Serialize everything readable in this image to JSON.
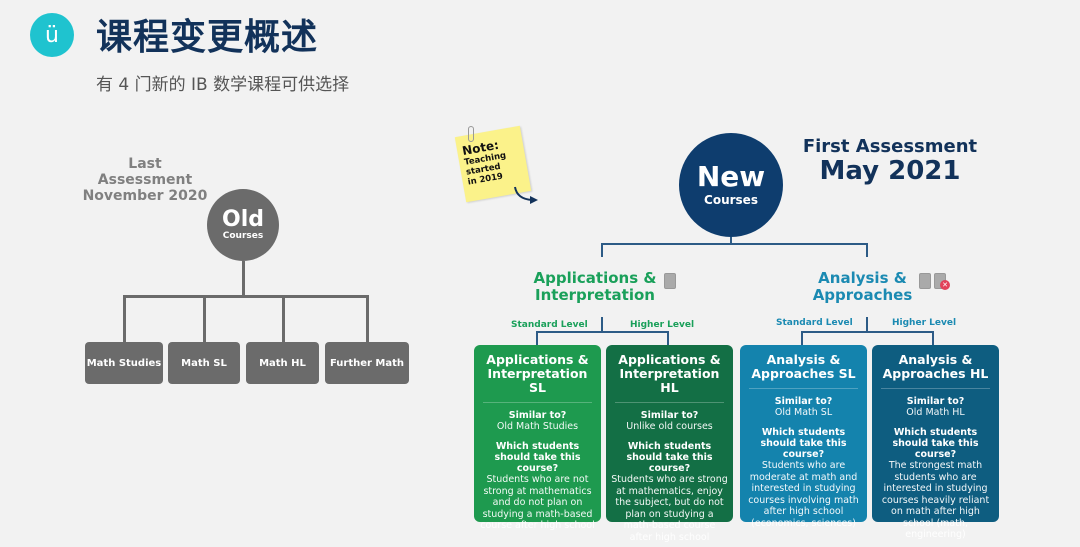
{
  "header": {
    "logo_glyph": "ü",
    "title": "课程变更概述",
    "subtitle": "有 4 门新的 IB 数学课程可供选择"
  },
  "old": {
    "label_line1": "Last Assessment",
    "label_line2": "November 2020",
    "circle_big": "Old",
    "circle_small": "Courses",
    "courses": [
      "Math Studies",
      "Math SL",
      "Math HL",
      "Further Math"
    ]
  },
  "note": {
    "heading": "Note:",
    "line1": "Teaching",
    "line2": "started",
    "line3": "in 2019"
  },
  "new": {
    "circle_big": "New",
    "circle_small": "Courses",
    "assess_line1": "First Assessment",
    "assess_line2": "May 2021",
    "paths": [
      {
        "title_line1": "Applications &",
        "title_line2": "Interpretation",
        "sl_label": "Standard Level",
        "hl_label": "Higher Level"
      },
      {
        "title_line1": "Analysis &",
        "title_line2": "Approaches",
        "sl_label": "Standard Level",
        "hl_label": "Higher Level"
      }
    ],
    "cards": [
      {
        "title_line1": "Applications &",
        "title_line2": "Interpretation SL",
        "similar_heading": "Similar to?",
        "similar_value": "Old Math Studies",
        "who_heading": "Which students should take this course?",
        "who_text": "Students who are not strong at mathematics and do not plan on studying a math-based course after high school",
        "color": "#1e9a4f"
      },
      {
        "title_line1": "Applications &",
        "title_line2": "Interpretation HL",
        "similar_heading": "Similar to?",
        "similar_value": "Unlike old courses",
        "who_heading": "Which students should take this course?",
        "who_text": "Students who are strong at mathematics, enjoy the subject, but do not plan on studying a math-based course after high school",
        "color": "#136f45"
      },
      {
        "title_line1": "Analysis &",
        "title_line2": "Approaches SL",
        "similar_heading": "Similar to?",
        "similar_value": "Old Math SL",
        "who_heading": "Which students should take this course?",
        "who_text": "Students who are moderate at math and interested in studying courses involving math after high school (economics, sciences)",
        "color": "#1483ad"
      },
      {
        "title_line1": "Analysis &",
        "title_line2": "Approaches HL",
        "similar_heading": "Similar to?",
        "similar_value": "Old Math HL",
        "who_heading": "Which students should take this course?",
        "who_text": "The strongest math students who are interested in studying courses heavily reliant on math after high school (math, engineering)",
        "color": "#0e5d80"
      }
    ]
  }
}
